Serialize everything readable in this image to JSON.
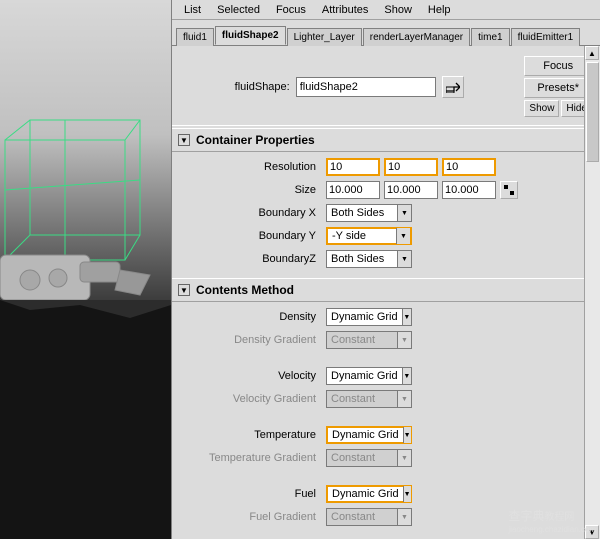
{
  "menubar": [
    "List",
    "Selected",
    "Focus",
    "Attributes",
    "Show",
    "Help"
  ],
  "tabs": [
    {
      "label": "fluid1",
      "active": false
    },
    {
      "label": "fluidShape2",
      "active": true
    },
    {
      "label": "Lighter_Layer",
      "active": false
    },
    {
      "label": "renderLayerManager",
      "active": false
    },
    {
      "label": "time1",
      "active": false
    },
    {
      "label": "fluidEmitter1",
      "active": false
    }
  ],
  "header": {
    "label": "fluidShape:",
    "value": "fluidShape2",
    "buttons": {
      "focus": "Focus",
      "presets": "Presets*",
      "show": "Show",
      "hide": "Hide"
    }
  },
  "sections": {
    "container": {
      "title": "Container Properties",
      "resolution": {
        "label": "Resolution",
        "x": "10",
        "y": "10",
        "z": "10"
      },
      "size": {
        "label": "Size",
        "x": "10.000",
        "y": "10.000",
        "z": "10.000"
      },
      "boundaryX": {
        "label": "Boundary X",
        "value": "Both Sides"
      },
      "boundaryY": {
        "label": "Boundary Y",
        "value": "-Y side"
      },
      "boundaryZ": {
        "label": "BoundaryZ",
        "value": "Both Sides"
      }
    },
    "contents": {
      "title": "Contents Method",
      "density": {
        "label": "Density",
        "value": "Dynamic Grid"
      },
      "densityGrad": {
        "label": "Density Gradient",
        "value": "Constant"
      },
      "velocity": {
        "label": "Velocity",
        "value": "Dynamic Grid"
      },
      "velocityGrad": {
        "label": "Velocity Gradient",
        "value": "Constant"
      },
      "temperature": {
        "label": "Temperature",
        "value": "Dynamic Grid"
      },
      "temperatureGrad": {
        "label": "Temperature Gradient",
        "value": "Constant"
      },
      "fuel": {
        "label": "Fuel",
        "value": "Dynamic Grid"
      },
      "fuelGrad": {
        "label": "Fuel Gradient",
        "value": "Constant"
      }
    }
  },
  "watermark": {
    "cn": "查字典",
    "en": "教程网",
    "url": "jiaocheng.chazidian.com"
  }
}
